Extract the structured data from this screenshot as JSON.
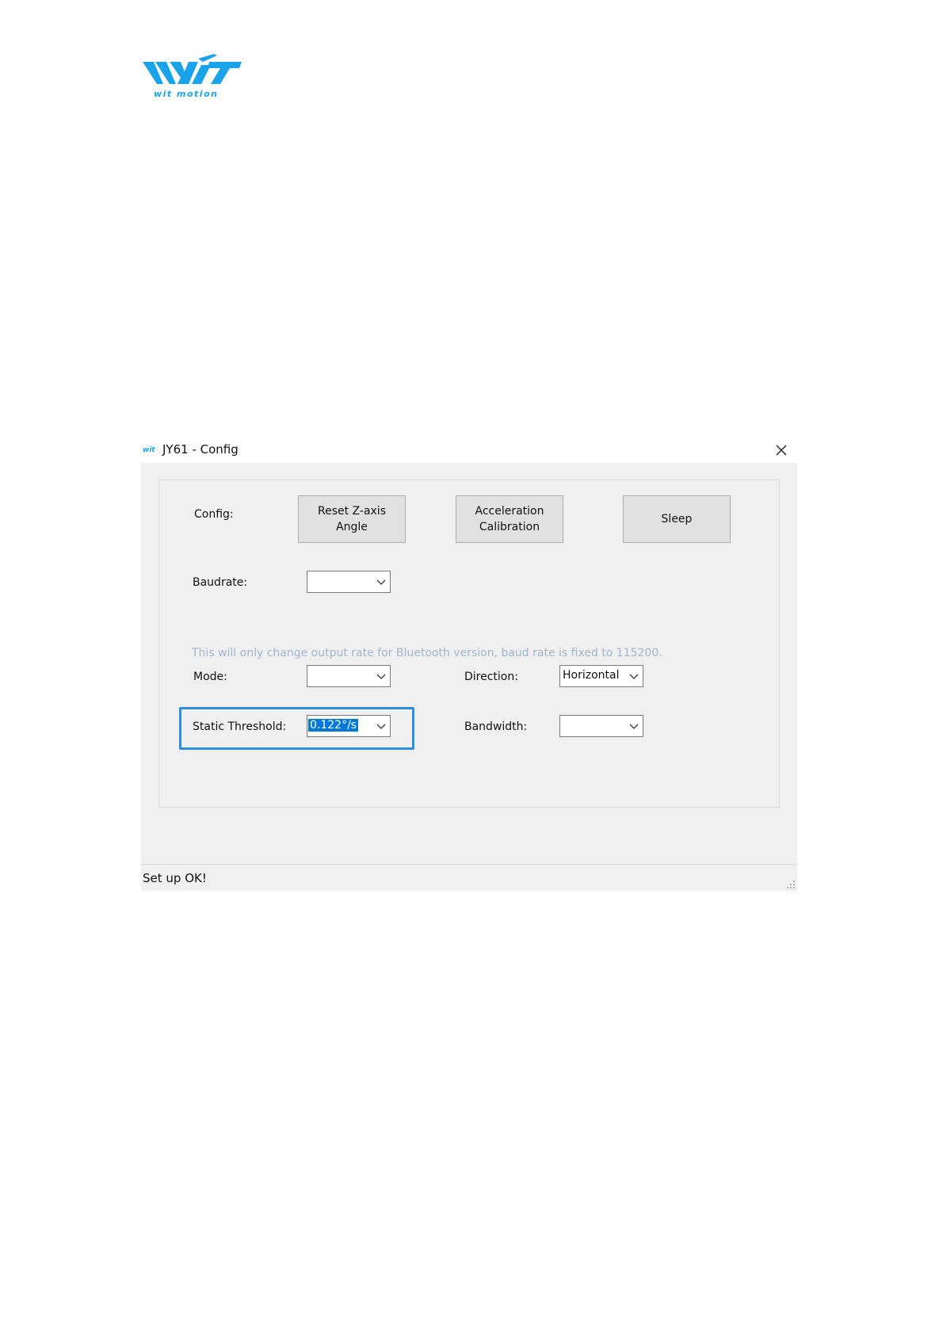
{
  "logo": {
    "wordmark": "wit motion"
  },
  "window": {
    "title": "JY61 - Config",
    "icon": "witmotion-app-icon",
    "close_icon": "close-icon",
    "accent_color": "#0078d7",
    "highlight_color": "#2b8fe0"
  },
  "config": {
    "label": "Config:",
    "buttons": {
      "reset_z_axis_line1": "Reset Z-axis",
      "reset_z_axis_line2": "Angle",
      "accel_calibration_line1": "Acceleration",
      "accel_calibration_line2": "Calibration",
      "sleep": "Sleep"
    }
  },
  "baudrate": {
    "label": "Baudrate:",
    "value": "",
    "hint": "This will only change output rate for Bluetooth version, baud rate is fixed to 115200."
  },
  "mode": {
    "label": "Mode:",
    "value": ""
  },
  "direction": {
    "label": "Direction:",
    "value": "Horizontal"
  },
  "static_threshold": {
    "label": "Static Threshold:",
    "value": "0.122°/s"
  },
  "bandwidth": {
    "label": "Bandwidth:",
    "value": ""
  },
  "status": {
    "text": "Set up OK!"
  }
}
